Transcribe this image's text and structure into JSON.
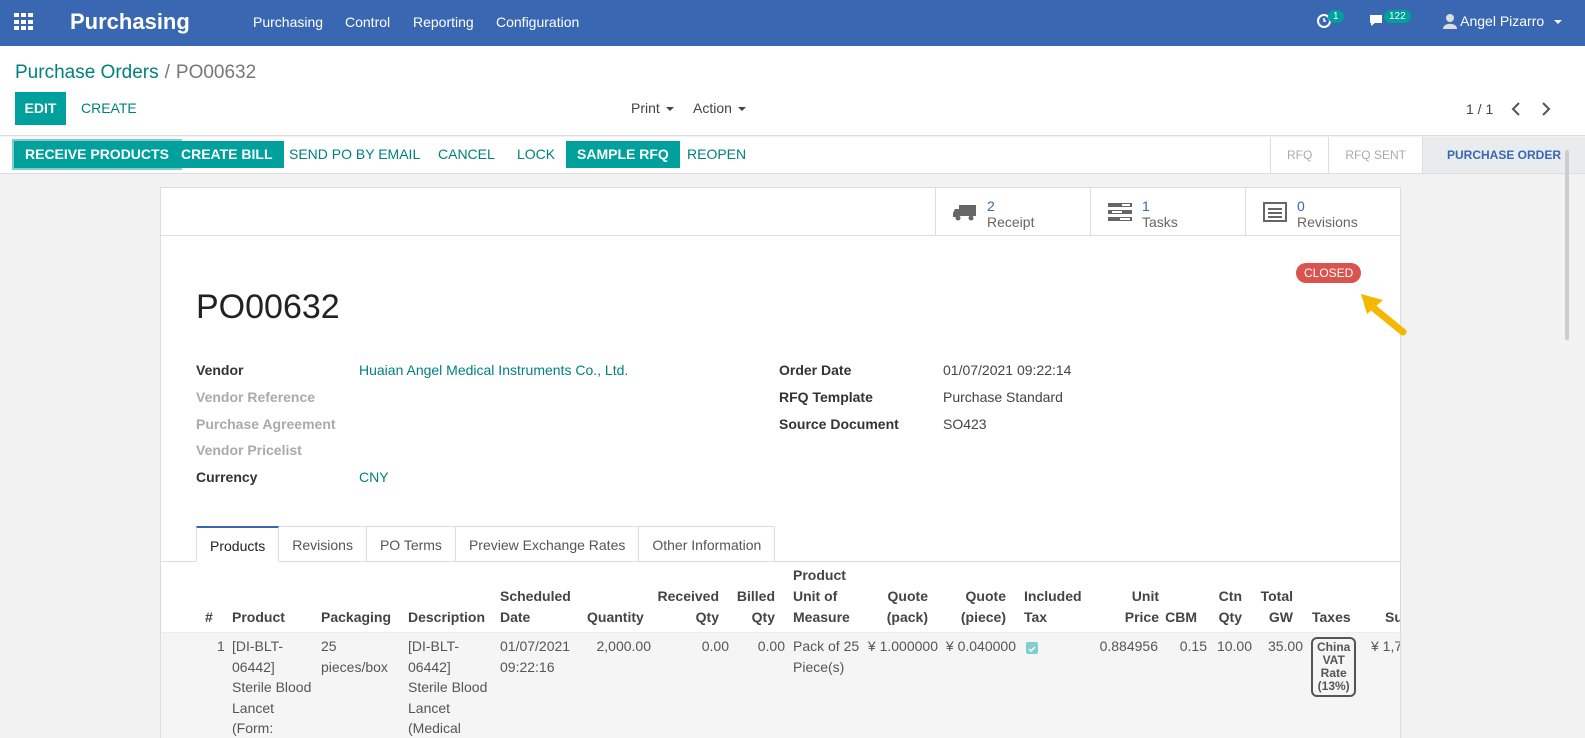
{
  "navbar": {
    "app_name": "Purchasing",
    "menu": [
      "Purchasing",
      "Control",
      "Reporting",
      "Configuration"
    ],
    "activity_count": "1",
    "messages_count": "122",
    "user": "Angel Pizarro",
    "color": "#3a67b1"
  },
  "control": {
    "breadcrumb_parent": "Purchase Orders",
    "breadcrumb_sep": "/",
    "breadcrumb_current": "PO00632",
    "edit_label": "EDIT",
    "create_label": "CREATE",
    "print_label": "Print",
    "action_label": "Action",
    "pager": "1 / 1"
  },
  "statusbar": {
    "buttons": [
      "RECEIVE PRODUCTS",
      "CREATE BILL",
      "SEND PO BY EMAIL",
      "CANCEL",
      "LOCK",
      "SAMPLE RFQ",
      "REOPEN"
    ],
    "stages": [
      "RFQ",
      "RFQ SENT",
      "PURCHASE ORDER"
    ],
    "active_stage": "PURCHASE ORDER"
  },
  "smart_buttons": [
    {
      "count": "2",
      "label": "Receipt",
      "icon": "truck-icon"
    },
    {
      "count": "1",
      "label": "Tasks",
      "icon": "tasks-icon"
    },
    {
      "count": "0",
      "label": "Revisions",
      "icon": "list-icon"
    }
  ],
  "status_badge": "CLOSED",
  "po_number": "PO00632",
  "fields_left": [
    {
      "label": "Vendor",
      "value": "Huaian Angel Medical Instruments Co., Ltd."
    },
    {
      "label": "Vendor Reference",
      "value": ""
    },
    {
      "label": "Purchase Agreement",
      "value": ""
    },
    {
      "label": "Vendor Pricelist",
      "value": ""
    },
    {
      "label": "Currency",
      "value": "CNY"
    }
  ],
  "fields_right": [
    {
      "label": "Order Date",
      "value": "01/07/2021 09:22:14"
    },
    {
      "label": "RFQ Template",
      "value": "Purchase Standard"
    },
    {
      "label": "Source Document",
      "value": "SO423"
    }
  ],
  "tabs": [
    "Products",
    "Revisions",
    "PO Terms",
    "Preview Exchange Rates",
    "Other Information"
  ],
  "columns": {
    "num": "#",
    "product": "Product",
    "packaging": "Packaging",
    "description": "Description",
    "sched1": "Scheduled",
    "sched2": "Date",
    "quantity": "Quantity",
    "recv1": "Received",
    "recv2": "Qty",
    "billed1": "Billed",
    "billed2": "Qty",
    "uom1": "Product",
    "uom2": "Unit of",
    "uom3": "Measure",
    "qpack1": "Quote",
    "qpack2": "(pack)",
    "qpiece1": "Quote",
    "qpiece2": "(piece)",
    "incl1": "Included",
    "incl2": "Tax",
    "unit1": "Unit",
    "unit2": "Price",
    "cbm": "CBM",
    "ctn1": "Ctn",
    "ctn2": "Qty",
    "gw1": "Total",
    "gw2": "GW",
    "taxes": "Taxes",
    "sub": "Su"
  },
  "row": {
    "num": "1",
    "product": [
      "[DI-BLT-",
      "06442]",
      "Sterile Blood",
      "Lancet",
      "(Form:"
    ],
    "packaging": [
      "25",
      "pieces/box"
    ],
    "description": [
      "[DI-BLT-",
      "06442]",
      "Sterile Blood",
      "Lancet",
      "(Medical"
    ],
    "sched": [
      "01/07/2021",
      "09:22:16"
    ],
    "quantity": "2,000.00",
    "received": "0.00",
    "billed": "0.00",
    "uom": [
      "Pack of 25",
      "Piece(s)"
    ],
    "quote_pack": "¥ 1.000000",
    "quote_piece": "¥ 0.040000",
    "unit_price": "0.884956",
    "cbm": "0.15",
    "ctn": "10.00",
    "gw": "35.00",
    "tax": [
      "China",
      "VAT",
      "Rate",
      "(13%)"
    ],
    "subtotal": "¥ 1,7"
  }
}
